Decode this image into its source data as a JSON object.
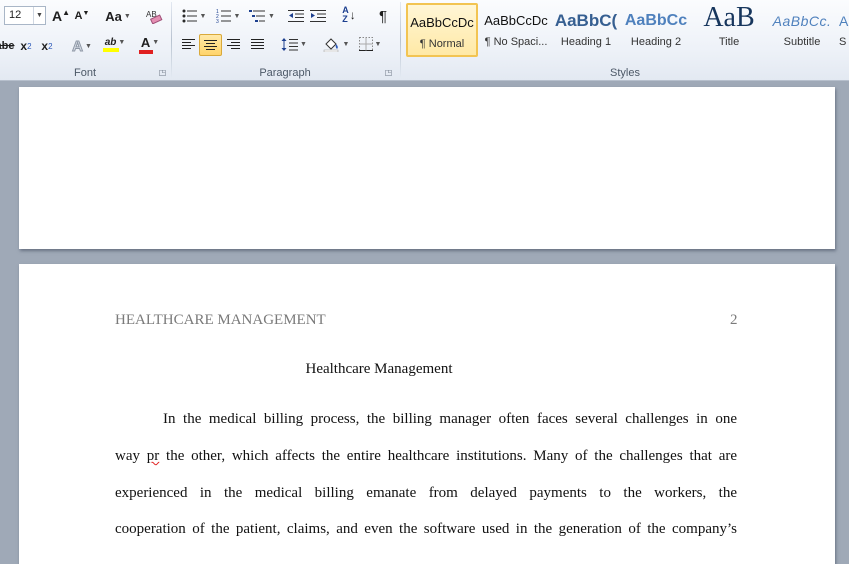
{
  "ribbon": {
    "font": {
      "label": "Font",
      "size_value": "12",
      "grow_glyph": "A",
      "shrink_glyph": "A",
      "case_glyph": "Aa",
      "strike_glyph": "abe",
      "subscript_glyph": "x",
      "subscript_mark": "2",
      "superscript_glyph": "x",
      "superscript_mark": "2",
      "effects_glyph": "A",
      "highlight_glyph": "ab",
      "color_glyph": "A",
      "highlight_color": "#ffff00",
      "font_color": "#e02020"
    },
    "paragraph": {
      "label": "Paragraph",
      "sort_glyph_a": "A",
      "sort_glyph_z": "Z",
      "pilcrow_glyph": "¶"
    },
    "styles": {
      "label": "Styles",
      "items": [
        {
          "sample": "AaBbCcDc",
          "name": "¶ Normal",
          "selected": true
        },
        {
          "sample": "AaBbCcDc",
          "name": "¶ No Spaci...",
          "selected": false
        },
        {
          "sample": "AaBbC(",
          "name": "Heading 1",
          "selected": false
        },
        {
          "sample": "AaBbCc",
          "name": "Heading 2",
          "selected": false
        },
        {
          "sample": "AaB",
          "name": "Title",
          "selected": false
        },
        {
          "sample": "AaBbCc.",
          "name": "Subtitle",
          "selected": false
        },
        {
          "sample": "A",
          "name": "S",
          "selected": false
        }
      ]
    }
  },
  "document": {
    "header_text": "HEALTHCARE MANAGEMENT",
    "page_number": "2",
    "title": "Healthcare Management",
    "lines": [
      {
        "pre": "In the medical billing process, the billing manager often faces several challenges in one"
      },
      {
        "pre": "way ",
        "typo": "pr",
        "post": " the other, which affects the entire healthcare institutions. Many of the challenges that are"
      },
      {
        "pre": "experienced in the medical billing emanate from delayed payments to the workers, the"
      },
      {
        "pre": "cooperation of the patient, claims, and even the software used in the generation of the company’s"
      }
    ]
  },
  "colors": {
    "workspace": "#9fa9b7",
    "style_selected_border": "#f2c452",
    "spelling_squiggle": "#e02020"
  }
}
